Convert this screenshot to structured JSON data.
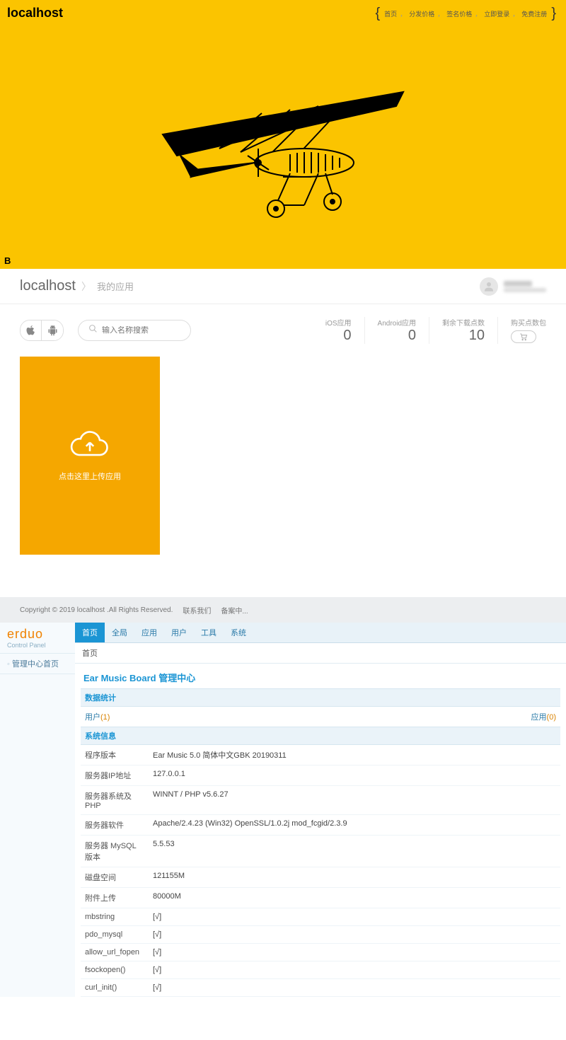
{
  "hero": {
    "title": "localhost",
    "nav": [
      "首页",
      "分发价格",
      "签名价格",
      "立即登录",
      "免费注册"
    ],
    "corner": "B"
  },
  "crumb": {
    "host": "localhost",
    "page": "我的应用"
  },
  "toolbar": {
    "search_placeholder": "输入名称搜索",
    "stats": {
      "ios": {
        "label": "iOS应用",
        "value": "0"
      },
      "android": {
        "label": "Android应用",
        "value": "0"
      },
      "dl": {
        "label": "剩余下载点数",
        "value": "10"
      }
    },
    "buy_label": "购买点数包"
  },
  "upload": {
    "text": "点击这里上传应用"
  },
  "footer": {
    "copyright": "Copyright © 2019 localhost .All Rights Reserved.",
    "links": [
      "联系我们",
      "备案中..."
    ]
  },
  "admin": {
    "logo1": "erduo",
    "logo2": "Control Panel",
    "side_item": "管理中心首页",
    "tabs": [
      "首页",
      "全局",
      "应用",
      "用户",
      "工具",
      "系统"
    ],
    "breadcrumb": "首页",
    "center_title": "Ear Music Board 管理中心",
    "stats_header": "数据统计",
    "stat_user_label": "用户",
    "stat_user_count": "(1)",
    "stat_app_label": "应用",
    "stat_app_count": "(0)",
    "sysinfo_header": "系统信息",
    "sysinfo": [
      {
        "k": "程序版本",
        "v": "Ear Music 5.0 简体中文GBK 20190311"
      },
      {
        "k": "服务器IP地址",
        "v": "127.0.0.1"
      },
      {
        "k": "服务器系统及 PHP",
        "v": "WINNT / PHP v5.6.27"
      },
      {
        "k": "服务器软件",
        "v": "Apache/2.4.23 (Win32) OpenSSL/1.0.2j mod_fcgid/2.3.9"
      },
      {
        "k": "服务器 MySQL 版本",
        "v": "5.5.53"
      },
      {
        "k": "磁盘空间",
        "v": "121155M"
      },
      {
        "k": "附件上传",
        "v": "80000M"
      },
      {
        "k": "mbstring",
        "v": "[√]",
        "green": true
      },
      {
        "k": "pdo_mysql",
        "v": "[√]",
        "green": true
      },
      {
        "k": "allow_url_fopen",
        "v": "[√]",
        "green": true
      },
      {
        "k": "fsockopen()",
        "v": "[√]",
        "green": true
      },
      {
        "k": "curl_init()",
        "v": "[√]",
        "green": true
      }
    ]
  }
}
